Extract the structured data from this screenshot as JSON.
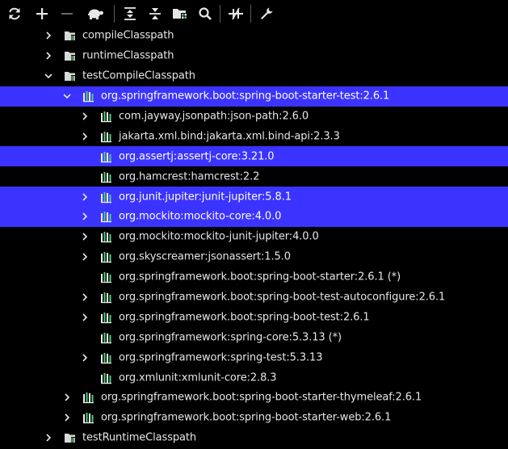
{
  "toolbar": {
    "buttons": [
      {
        "name": "refresh-icon"
      },
      {
        "name": "add-icon"
      },
      {
        "name": "remove-icon"
      },
      {
        "name": "turtle-offline-icon"
      },
      {
        "name": "expand-all-icon"
      },
      {
        "name": "collapse-all-icon"
      },
      {
        "name": "folder-tasks-icon"
      },
      {
        "name": "search-icon"
      },
      {
        "name": "toggle-skip-tests-icon"
      },
      {
        "name": "wrench-settings-icon"
      }
    ]
  },
  "colors": {
    "background": "#000000",
    "selection": "#3b33ff",
    "text": "#e6e6e6",
    "folder_icon": "#d9d9d9",
    "library_green": "#4fd07a",
    "library_white": "#f0f0f0"
  },
  "tree": {
    "rows": [
      {
        "label": "compileClasspath",
        "level": 1,
        "icon": "config-folder-icon",
        "chevron": "right",
        "selected": false
      },
      {
        "label": "runtimeClasspath",
        "level": 1,
        "icon": "config-folder-icon",
        "chevron": "right",
        "selected": false
      },
      {
        "label": "testCompileClasspath",
        "level": 1,
        "icon": "config-folder-icon",
        "chevron": "down",
        "selected": false
      },
      {
        "label": "org.springframework.boot:spring-boot-starter-test:2.6.1",
        "level": 2,
        "icon": "library-icon",
        "chevron": "down",
        "selected": true
      },
      {
        "label": "com.jayway.jsonpath:json-path:2.6.0",
        "level": 3,
        "icon": "library-icon",
        "chevron": "right",
        "selected": false
      },
      {
        "label": "jakarta.xml.bind:jakarta.xml.bind-api:2.3.3",
        "level": 3,
        "icon": "library-icon",
        "chevron": "right",
        "selected": false
      },
      {
        "label": "org.assertj:assertj-core:3.21.0",
        "level": 3,
        "icon": "library-icon",
        "chevron": "none",
        "selected": true
      },
      {
        "label": "org.hamcrest:hamcrest:2.2",
        "level": 3,
        "icon": "library-icon",
        "chevron": "none",
        "selected": false
      },
      {
        "label": "org.junit.jupiter:junit-jupiter:5.8.1",
        "level": 3,
        "icon": "library-icon",
        "chevron": "right",
        "selected": true
      },
      {
        "label": "org.mockito:mockito-core:4.0.0",
        "level": 3,
        "icon": "library-icon",
        "chevron": "right",
        "selected": true
      },
      {
        "label": "org.mockito:mockito-junit-jupiter:4.0.0",
        "level": 3,
        "icon": "library-icon",
        "chevron": "right",
        "selected": false
      },
      {
        "label": "org.skyscreamer:jsonassert:1.5.0",
        "level": 3,
        "icon": "library-icon",
        "chevron": "right",
        "selected": false
      },
      {
        "label": "org.springframework.boot:spring-boot-starter:2.6.1 (*)",
        "level": 3,
        "icon": "library-icon",
        "chevron": "none",
        "selected": false
      },
      {
        "label": "org.springframework.boot:spring-boot-test-autoconfigure:2.6.1",
        "level": 3,
        "icon": "library-icon",
        "chevron": "right",
        "selected": false
      },
      {
        "label": "org.springframework.boot:spring-boot-test:2.6.1",
        "level": 3,
        "icon": "library-icon",
        "chevron": "right",
        "selected": false
      },
      {
        "label": "org.springframework:spring-core:5.3.13 (*)",
        "level": 3,
        "icon": "library-icon",
        "chevron": "none",
        "selected": false
      },
      {
        "label": "org.springframework:spring-test:5.3.13",
        "level": 3,
        "icon": "library-icon",
        "chevron": "right",
        "selected": false
      },
      {
        "label": "org.xmlunit:xmlunit-core:2.8.3",
        "level": 3,
        "icon": "library-icon",
        "chevron": "none",
        "selected": false
      },
      {
        "label": "org.springframework.boot:spring-boot-starter-thymeleaf:2.6.1",
        "level": 2,
        "icon": "library-icon",
        "chevron": "right",
        "selected": false
      },
      {
        "label": "org.springframework.boot:spring-boot-starter-web:2.6.1",
        "level": 2,
        "icon": "library-icon",
        "chevron": "right",
        "selected": false
      },
      {
        "label": "testRuntimeClasspath",
        "level": 1,
        "icon": "config-folder-icon",
        "chevron": "right",
        "selected": false
      }
    ]
  }
}
